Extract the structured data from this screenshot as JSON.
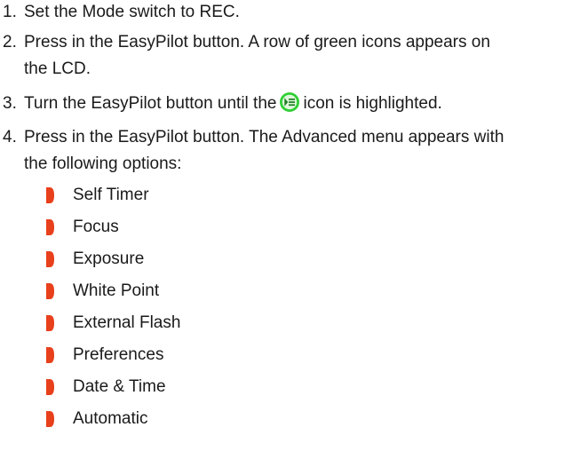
{
  "steps": [
    {
      "number": "1.",
      "text": "Set the Mode switch to REC."
    },
    {
      "number": "2.",
      "line1": "Press in the EasyPilot button. A row of green icons appears on",
      "line2": "the LCD."
    },
    {
      "number": "3.",
      "before_icon": "Turn the EasyPilot button until the",
      "after_icon": "icon is highlighted.",
      "icon": "advanced-menu-icon"
    },
    {
      "number": "4.",
      "line1": "Press in the EasyPilot button. The Advanced menu appears with",
      "line2": "the following options:"
    }
  ],
  "options": [
    "Self Timer",
    "Focus",
    "Exposure",
    "White Point",
    "External Flash",
    "Preferences",
    "Date & Time",
    "Automatic"
  ],
  "colors": {
    "text": "#1a1a1a",
    "bullet": "#e8401c",
    "icon_green": "#2fcf34",
    "icon_dark": "#1f7d22"
  }
}
